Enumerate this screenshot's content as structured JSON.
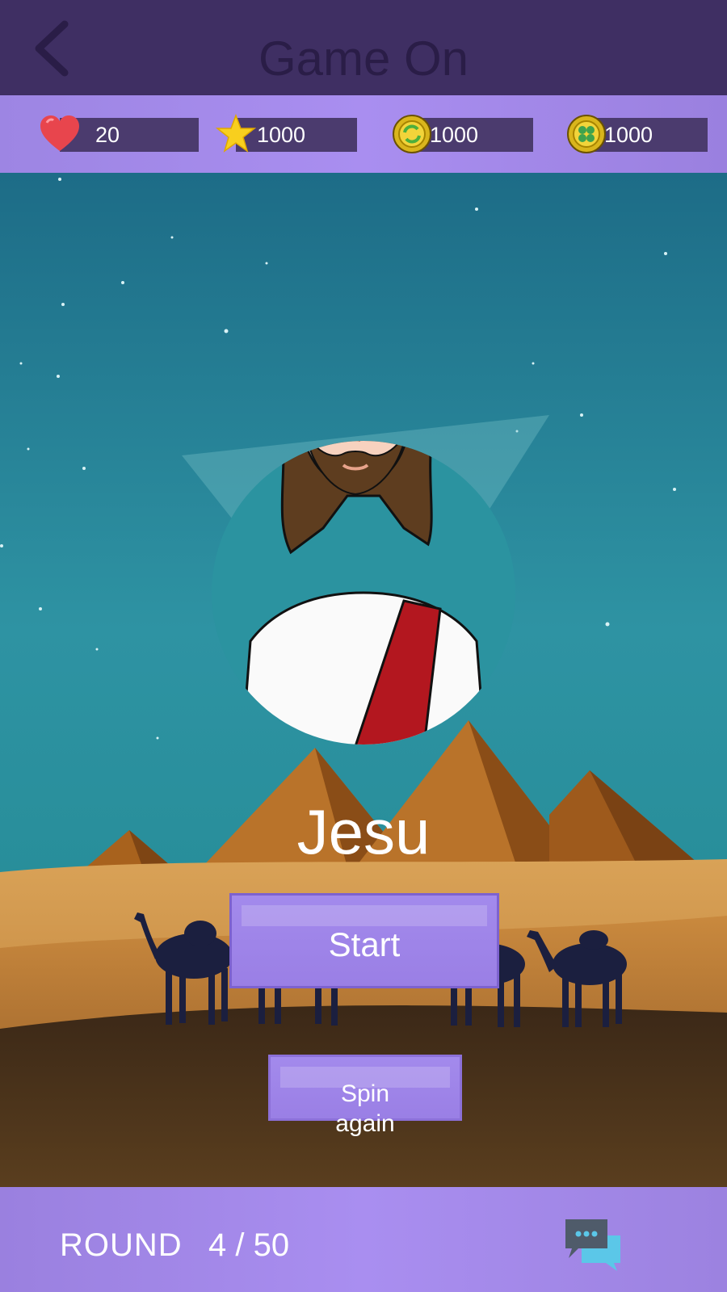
{
  "header": {
    "title": "Game On"
  },
  "stats": {
    "lives": {
      "icon": "heart-icon",
      "value": "20"
    },
    "stars": {
      "icon": "star-icon",
      "value": "1000"
    },
    "coins": {
      "icon": "refresh-coin-icon",
      "value": "1000"
    },
    "clover_coins": {
      "icon": "clover-coin-icon",
      "value": "1000"
    }
  },
  "character": {
    "name": "Jesu"
  },
  "buttons": {
    "start": "Start",
    "spin_line1": "Spin",
    "spin_line2": "again"
  },
  "footer": {
    "round_label": "ROUND",
    "round_value": "4 / 50",
    "chat_icon": "chat-icon"
  },
  "colors": {
    "header": "#3f2f63",
    "bar": "#a38aec",
    "sky": "#2a8b98",
    "sand": "#c48a3c"
  }
}
